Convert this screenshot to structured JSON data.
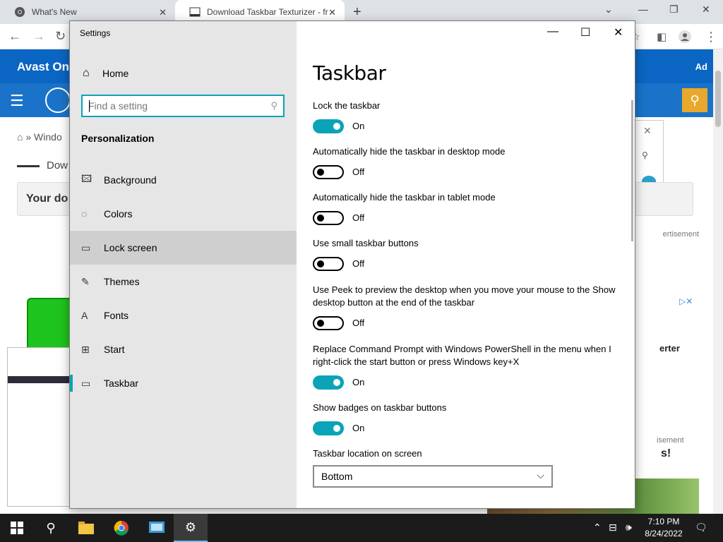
{
  "browser": {
    "tabs": [
      {
        "title": "What's New"
      },
      {
        "title": "Download Taskbar Texturizer - fr"
      }
    ]
  },
  "webpage": {
    "brand": "Avast One",
    "ad_label": "Ad",
    "breadcrumb": "Windo",
    "download_title": "Dow",
    "box_text": "Your do",
    "advertisement_1": "ertisement",
    "side_text_1": "erter",
    "advertisement_2": "isement",
    "side_text_2": "s!"
  },
  "settings": {
    "window_title": "Settings",
    "home_label": "Home",
    "search_placeholder": "Find a setting",
    "section_label": "Personalization",
    "nav_items": [
      {
        "label": "Background",
        "icon": "picture-icon"
      },
      {
        "label": "Colors",
        "icon": "palette-icon"
      },
      {
        "label": "Lock screen",
        "icon": "lock-screen-icon"
      },
      {
        "label": "Themes",
        "icon": "brush-icon"
      },
      {
        "label": "Fonts",
        "icon": "fonts-icon"
      },
      {
        "label": "Start",
        "icon": "start-icon"
      },
      {
        "label": "Taskbar",
        "icon": "taskbar-icon"
      }
    ],
    "page_title": "Taskbar",
    "options": [
      {
        "label": "Lock the taskbar",
        "state": "On"
      },
      {
        "label": "Automatically hide the taskbar in desktop mode",
        "state": "Off"
      },
      {
        "label": "Automatically hide the taskbar in tablet mode",
        "state": "Off"
      },
      {
        "label": "Use small taskbar buttons",
        "state": "Off"
      },
      {
        "label": "Use Peek to preview the desktop when you move your mouse to the Show desktop button at the end of the taskbar",
        "state": "Off"
      },
      {
        "label": "Replace Command Prompt with Windows PowerShell in the menu when I right-click the start button or press Windows key+X",
        "state": "On"
      },
      {
        "label": "Show badges on taskbar buttons",
        "state": "On"
      }
    ],
    "location_label": "Taskbar location on screen",
    "location_value": "Bottom"
  },
  "taskbar": {
    "time": "7:10 PM",
    "date": "8/24/2022"
  },
  "colors": {
    "accent": "#0aa3b8",
    "avast_blue": "#0a66c2",
    "taskbar_bg": "#1b1b1b"
  }
}
